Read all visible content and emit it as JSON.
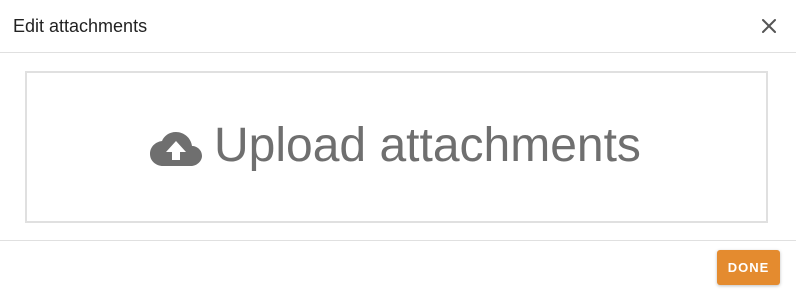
{
  "dialog": {
    "title": "Edit attachments",
    "close_icon": "close-icon"
  },
  "dropzone": {
    "icon": "cloud-upload-icon",
    "label": "Upload attachments"
  },
  "footer": {
    "done_label": "DONE"
  },
  "colors": {
    "accent": "#e48b2f",
    "text_muted": "#6f6f6f",
    "border": "#e0e0e0"
  }
}
